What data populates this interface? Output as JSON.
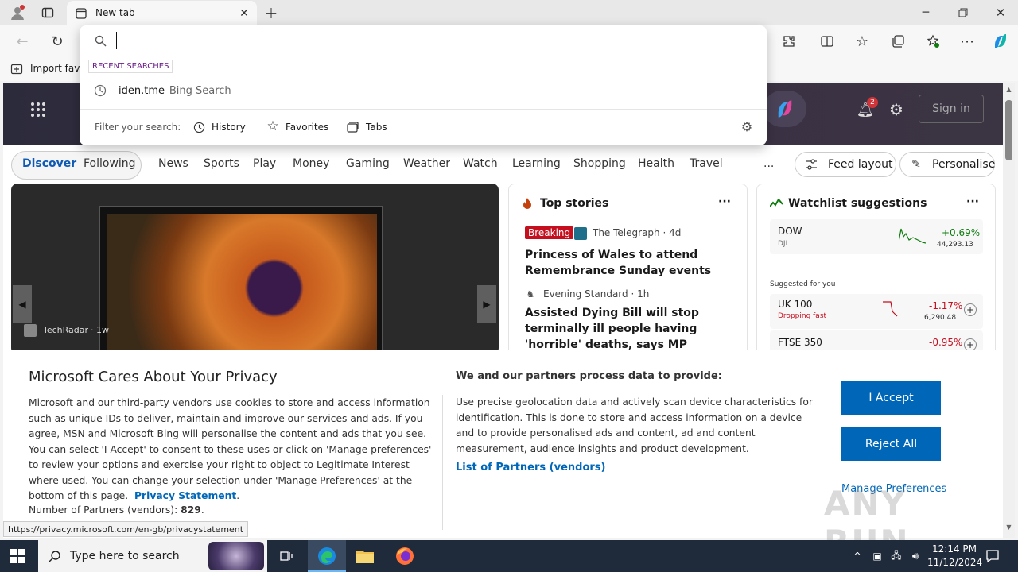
{
  "browser": {
    "tab_title": "New tab",
    "address_value": "",
    "favorites_bar_label": "Import favo"
  },
  "omnibox": {
    "recent_header": "RECENT SEARCHES",
    "suggestion_query": "iden.tme",
    "suggestion_source": " - Bing Search",
    "filter_label": "Filter your search:",
    "filters": [
      "History",
      "Favorites",
      "Tabs"
    ]
  },
  "msn": {
    "signin": "Sign in",
    "notifications_count": "2",
    "nav": [
      "Discover",
      "Following",
      "News",
      "Sports",
      "Play",
      "Money",
      "Gaming",
      "Weather",
      "Watch",
      "Learning",
      "Shopping",
      "Health",
      "Travel"
    ],
    "more": "...",
    "feed_layout": "Feed layout",
    "personalise": "Personalise",
    "hero_source": "TechRadar",
    "hero_age": "· 1w",
    "top_stories": {
      "title": "Top stories",
      "stories": [
        {
          "badge": "Breaking",
          "source": "The Telegraph · 4d",
          "headline": "Princess of Wales to attend Remembrance Sunday events"
        },
        {
          "badge": "",
          "source": "Evening Standard · 1h",
          "headline": "Assisted Dying Bill will stop terminally ill people having 'horrible' deaths, says MP"
        }
      ]
    },
    "watchlist": {
      "title": "Watchlist suggestions",
      "suggested_label": "Suggested for you",
      "items": [
        {
          "name": "DOW",
          "sub": "DJI",
          "change": "+0.69%",
          "value": "44,293.13",
          "color": "#107c10"
        },
        {
          "name": "UK 100",
          "sub": "Dropping fast",
          "change": "-1.17%",
          "value": "6,290.48",
          "color": "#c50f1f"
        },
        {
          "name": "FTSE 350",
          "sub": "",
          "change": "-0.95%",
          "value": "",
          "color": "#c50f1f"
        }
      ]
    }
  },
  "consent": {
    "title": "Microsoft Cares About Your Privacy",
    "body": "Microsoft and our third-party vendors use cookies to store and access information such as unique IDs to deliver, maintain and improve our services and ads. If you agree, MSN and Microsoft Bing will personalise the content and ads that you see. You can select 'I Accept' to consent to these uses or click on 'Manage preferences' to review your options and exercise your right to object to Legitimate Interest where used.  You can change your selection under 'Manage Preferences' at the bottom of this page.",
    "privacy_link": "Privacy Statement",
    "partners_label": "Number of Partners (vendors):",
    "partners_count": "829",
    "right_title": "We and our partners process data to provide:",
    "right_body": "Use precise geolocation data and actively scan device characteristics for identification. This is done to store and access information on a device and to provide personalised ads and content, ad and content measurement, audience insights and product development.",
    "partners_link": "List of Partners (vendors)",
    "accept": "I Accept",
    "reject": "Reject All",
    "manage": "Manage Preferences"
  },
  "status_url": "https://privacy.microsoft.com/en-gb/privacystatement",
  "taskbar": {
    "search_placeholder": "Type here to search",
    "time": "12:14 PM",
    "date": "11/12/2024"
  },
  "watermark": "ANY RUN"
}
